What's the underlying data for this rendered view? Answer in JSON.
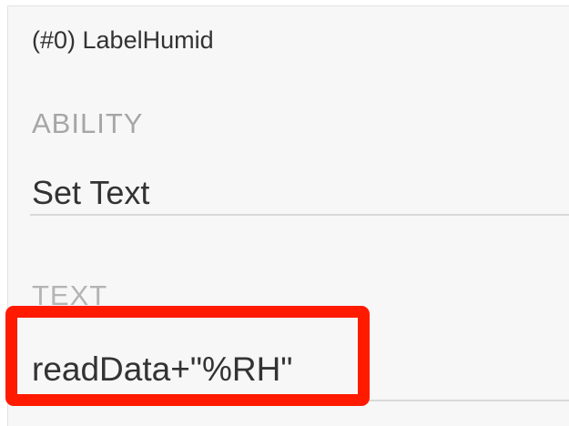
{
  "inspector": {
    "component_title": "(#0) LabelHumid",
    "ability": {
      "label": "ABILITY",
      "value": "Set Text"
    },
    "text": {
      "label": "TEXT",
      "value": "readData+\"%RH\""
    },
    "highlight_color": "#ff1a00"
  }
}
